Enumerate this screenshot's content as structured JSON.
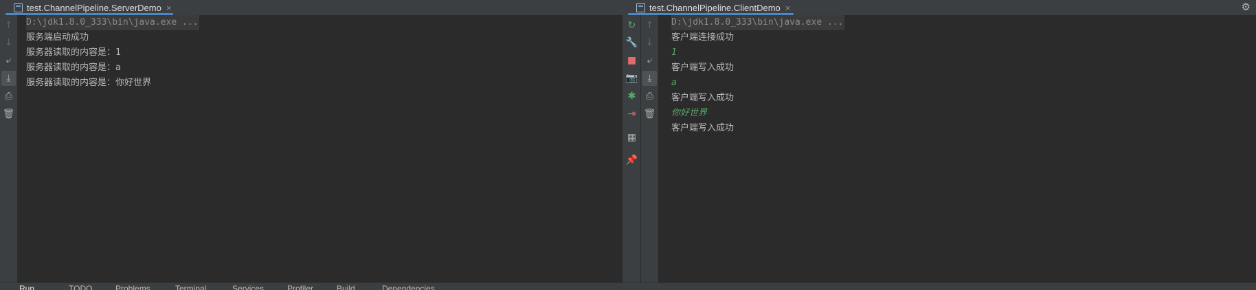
{
  "tabs": [
    {
      "title": "test.ChannelPipeline.ServerDemo",
      "close": "×"
    },
    {
      "title": "test.ChannelPipeline.ClientDemo",
      "close": "×"
    }
  ],
  "server_console": {
    "command": "D:\\jdk1.8.0_333\\bin\\java.exe ...",
    "lines": [
      "服务端启动成功",
      "服务器读取的内容是：1",
      "服务器读取的内容是：a",
      "服务器读取的内容是：你好世界"
    ]
  },
  "client_console": {
    "command": "D:\\jdk1.8.0_333\\bin\\java.exe ...",
    "lines": [
      {
        "text": "客户端连接成功",
        "kind": "output"
      },
      {
        "text": "1",
        "kind": "user-input"
      },
      {
        "text": "客户端写入成功",
        "kind": "output"
      },
      {
        "text": "a",
        "kind": "user-input"
      },
      {
        "text": "客户端写入成功",
        "kind": "output"
      },
      {
        "text": "你好世界",
        "kind": "user-input"
      },
      {
        "text": "客户端写入成功",
        "kind": "output"
      }
    ]
  },
  "bottom_toolbar": {
    "items": [
      "Run",
      "TODO",
      "Problems",
      "Terminal",
      "Services",
      "Profiler",
      "Build",
      "Dependencies"
    ]
  },
  "colors": {
    "background": "#2b2b2b",
    "toolbar": "#3c3f41",
    "tab_underline": "#4a88c7",
    "user_input": "#59a869",
    "stop_icon": "#e06c6c"
  },
  "icons": {
    "settings": "gear-icon",
    "server_gutter": [
      "arrow-up-icon",
      "arrow-down-icon",
      "soft-wrap-icon",
      "scroll-to-end-icon",
      "print-icon",
      "trash-icon"
    ],
    "client_gutter": [
      "rerun-icon",
      "wrench-icon",
      "stop-icon",
      "camera-icon",
      "debug-bug-icon",
      "exit-icon",
      "layout-icon",
      "pin-icon"
    ]
  }
}
